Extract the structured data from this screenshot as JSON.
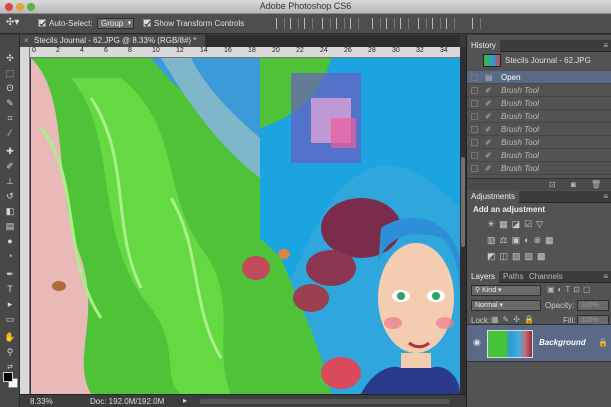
{
  "window": {
    "title": "Adobe Photoshop CS6"
  },
  "options_bar": {
    "auto_select_label": "Auto-Select:",
    "auto_select_value": "Group",
    "show_transform_label": "Show Transform Controls"
  },
  "document": {
    "tab_title": "Stecils Journal - 62.JPG @ 8.33% (RGB/8#) *",
    "ruler_ticks": [
      "0",
      "2",
      "4",
      "6",
      "8",
      "10",
      "12",
      "14",
      "16",
      "18",
      "20",
      "22",
      "24",
      "26",
      "28",
      "30",
      "32",
      "34"
    ]
  },
  "status": {
    "zoom": "8.33%",
    "doc_info": "Doc: 192.0M/192.0M"
  },
  "history": {
    "tab": "History",
    "snapshot_name": "Stecils Journal - 62.JPG",
    "items": [
      {
        "label": "Open",
        "active": true
      },
      {
        "label": "Brush Tool",
        "active": false
      },
      {
        "label": "Brush Tool",
        "active": false
      },
      {
        "label": "Brush Tool",
        "active": false
      },
      {
        "label": "Brush Tool",
        "active": false
      },
      {
        "label": "Brush Tool",
        "active": false
      },
      {
        "label": "Brush Tool",
        "active": false
      },
      {
        "label": "Brush Tool",
        "active": false
      }
    ]
  },
  "adjustments": {
    "tab": "Adjustments",
    "title": "Add an adjustment"
  },
  "layers": {
    "tabs": [
      "Layers",
      "Paths",
      "Channels"
    ],
    "filter_label": "Kind",
    "blend_mode": "Normal",
    "opacity_label": "Opacity:",
    "opacity_value": "100%",
    "lock_label": "Lock:",
    "fill_label": "Fill:",
    "fill_value": "100%",
    "layer_name": "Background"
  },
  "colors": {
    "selection": "#5a6a86",
    "panel_bg": "#535353",
    "toolbar_bg": "#484848"
  }
}
